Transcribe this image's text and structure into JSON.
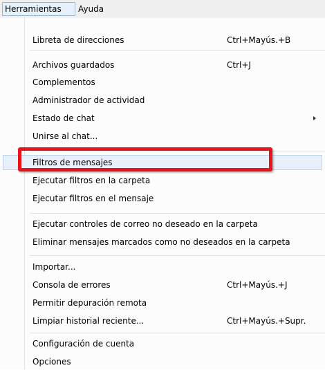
{
  "menubar": {
    "items": [
      {
        "label": "Herramientas",
        "active": true
      },
      {
        "label": "Ayuda",
        "active": false
      }
    ]
  },
  "menu": {
    "items": [
      {
        "label": "Libreta de direcciones",
        "shortcut": "Ctrl+Mayús.+B"
      },
      {
        "label": "Archivos guardados",
        "shortcut": "Ctrl+J"
      },
      {
        "label": "Complementos",
        "shortcut": ""
      },
      {
        "label": "Administrador de actividad",
        "shortcut": ""
      },
      {
        "label": "Estado de chat",
        "shortcut": "",
        "submenu": true
      },
      {
        "label": "Unirse al chat...",
        "shortcut": ""
      },
      {
        "label": "Filtros de mensajes",
        "shortcut": "",
        "highlighted": true
      },
      {
        "label": "Ejecutar filtros en la carpeta",
        "shortcut": ""
      },
      {
        "label": "Ejecutar filtros en el mensaje",
        "shortcut": ""
      },
      {
        "label": "Ejecutar controles de correo no deseado en la carpeta",
        "shortcut": ""
      },
      {
        "label": "Eliminar mensajes marcados como no deseados en la carpeta",
        "shortcut": ""
      },
      {
        "label": "Importar...",
        "shortcut": ""
      },
      {
        "label": "Consola de errores",
        "shortcut": "Ctrl+Mayús.+J"
      },
      {
        "label": "Permitir depuración remota",
        "shortcut": ""
      },
      {
        "label": "Limpiar historial reciente...",
        "shortcut": "Ctrl+Mayús.+Supr."
      },
      {
        "label": "Configuración de cuenta",
        "shortcut": ""
      },
      {
        "label": "Opciones",
        "shortcut": ""
      }
    ]
  },
  "annotation": {
    "color": "#e8141b"
  }
}
